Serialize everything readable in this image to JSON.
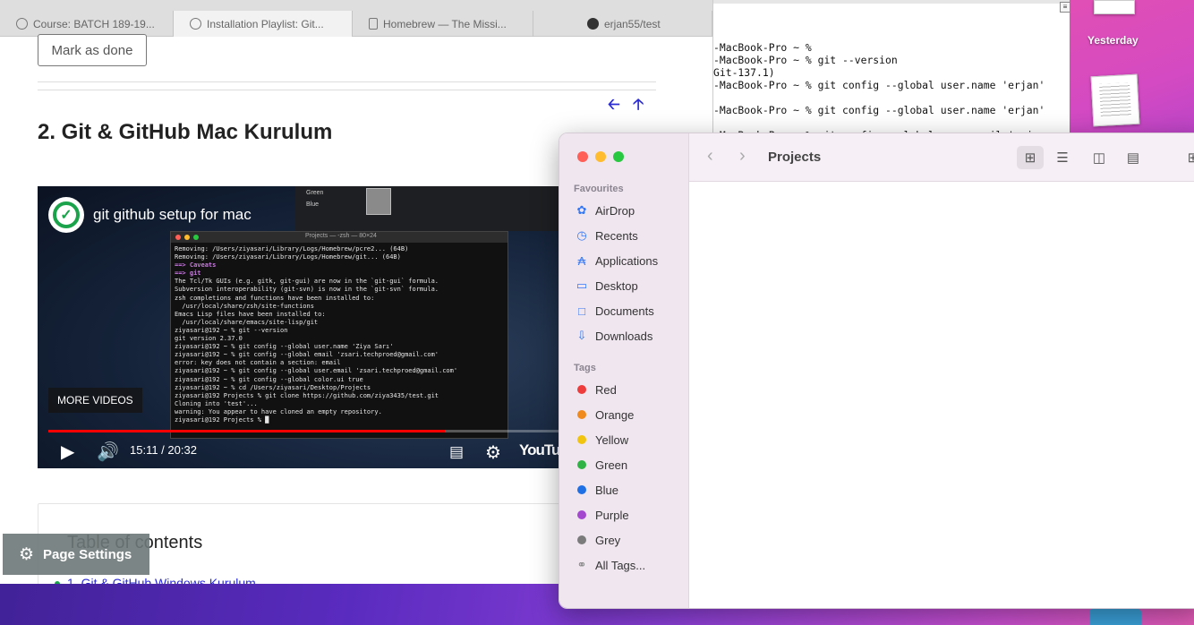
{
  "browser": {
    "tabs": [
      {
        "label": "Course: BATCH 189-19...",
        "icon": "check-circle-icon"
      },
      {
        "label": "Installation Playlist: Git...",
        "icon": "check-circle-icon"
      },
      {
        "label": "Homebrew — The Missi...",
        "icon": "document-icon"
      },
      {
        "label": "erjan55/test",
        "icon": "github-icon"
      }
    ],
    "mark_done_label": "Mark as done",
    "section_title": "2. Git & GitHub Mac Kurulum",
    "video": {
      "title": "git github setup for mac",
      "more_videos": "MORE VIDEOS",
      "time": "15:11 / 20:32",
      "progress": 0.739,
      "brand": "YouTube",
      "terminal_title": "Projects — -zsh — 80×24",
      "legend": [
        "Green",
        "Blue"
      ],
      "terminal_lines": [
        "Removing: /Users/ziyasari/Library/Logs/Homebrew/pcre2... (64B)",
        "Removing: /Users/ziyasari/Library/Logs/Homebrew/git... (64B)",
        "==> Caveats",
        "==> git",
        "The Tcl/Tk GUIs (e.g. gitk, git-gui) are now in the `git-gui` formula.",
        "Subversion interoperability (git-svn) is now in the `git-svn` formula.",
        "",
        "zsh completions and functions have been installed to:",
        "  /usr/local/share/zsh/site-functions",
        "",
        "Emacs Lisp files have been installed to:",
        "  /usr/local/share/emacs/site-lisp/git",
        "ziyasari@192 ~ % git --version",
        "git version 2.37.0",
        "ziyasari@192 ~ % git config --global user.name 'Ziya Sarı'",
        "ziyasari@192 ~ % git config --global email 'zsari.techproed@gmail.com'",
        "error: key does not contain a section: email",
        "ziyasari@192 ~ % git config --global user.email 'zsari.techproed@gmail.com'",
        "ziyasari@192 ~ % git config --global color.ui true",
        "ziyasari@192 ~ % cd /Users/ziyasari/Desktop/Projects",
        "ziyasari@192 Projects % git clone https://github.com/ziya3435/test.git",
        "Cloning into 'test'...",
        "warning: You appear to have cloned an empty repository.",
        "ziyasari@192 Projects % █"
      ]
    },
    "toc_title": "Table of contents",
    "toc_item": "1. Git & GitHub Windows Kurulum",
    "page_settings": "Page Settings"
  },
  "terminal": {
    "lines": [
      "-MacBook-Pro ~ %",
      "-MacBook-Pro ~ % git --version",
      "Git-137.1)",
      "-MacBook-Pro ~ % git config --global user.name 'erjan'",
      "",
      "-MacBook-Pro ~ % git config --global user.name 'erjan'",
      "",
      "-MacBook-Pro ~ % git config --global user.email 'erjan"
    ]
  },
  "desktop": {
    "label": "Yesterday"
  },
  "finder": {
    "title": "Projects",
    "favourites_header": "Favourites",
    "favourites": [
      {
        "label": "AirDrop",
        "icon": "airdrop-icon"
      },
      {
        "label": "Recents",
        "icon": "clock-icon"
      },
      {
        "label": "Applications",
        "icon": "applications-icon"
      },
      {
        "label": "Desktop",
        "icon": "desktop-icon"
      },
      {
        "label": "Documents",
        "icon": "document-icon"
      },
      {
        "label": "Downloads",
        "icon": "download-icon"
      }
    ],
    "tags_header": "Tags",
    "tags": [
      {
        "label": "Red",
        "color": "#ee3b3b"
      },
      {
        "label": "Orange",
        "color": "#f08a1c"
      },
      {
        "label": "Yellow",
        "color": "#f1c40f"
      },
      {
        "label": "Green",
        "color": "#2fb344"
      },
      {
        "label": "Blue",
        "color": "#1f6fe5"
      },
      {
        "label": "Purple",
        "color": "#a448d0"
      },
      {
        "label": "Grey",
        "color": "#7b7b7b"
      }
    ],
    "all_tags": "All Tags..."
  }
}
